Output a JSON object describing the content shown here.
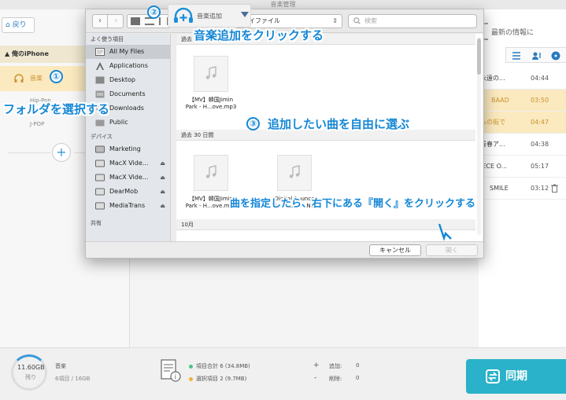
{
  "app": {
    "window_title": "音楽管理",
    "back_label": "戻り",
    "device_name": "俺のiPhone",
    "music_label": "音楽",
    "playlists": [
      "Hip-Pop",
      "J-POP"
    ],
    "latest_info": "最新の情報に",
    "tracks": [
      {
        "title": "永遠の...",
        "duration": "04:44"
      },
      {
        "title": "BAAD",
        "duration": "03:50"
      },
      {
        "title": "らの街で",
        "duration": "04:47"
      },
      {
        "title": "青春ア...",
        "duration": "04:38"
      },
      {
        "title": "IECE O...",
        "duration": "05:17"
      },
      {
        "title": "SMILE",
        "duration": "03:12"
      }
    ]
  },
  "bottom": {
    "storage_used": "11.60GB",
    "storage_sub": "残り",
    "category": "音楽",
    "category_detail": "6項目 / 16GB",
    "total_label": "項目合計 6 (34.8MB)",
    "selected_label": "選択項目 2 (9.7MB)",
    "added_label": "追加:",
    "added_value": "0",
    "deleted_label": "削除:",
    "deleted_value": "0",
    "sync_label": "同期",
    "plus": "+",
    "minus": "-"
  },
  "dialog": {
    "location": "マイファイル",
    "search_placeholder": "検索",
    "add_music_label": "音楽追加",
    "sidebar_favorites_header": "よく使う項目",
    "favorites": [
      "All My Files",
      "Applications",
      "Desktop",
      "Documents",
      "Downloads",
      "Public"
    ],
    "sidebar_devices_header": "デバイス",
    "devices": [
      "Marketing",
      "MacX Vide...",
      "MacX Vide...",
      "DearMob",
      "MediaTrans"
    ],
    "sidebar_shared_header": "共有",
    "sections": [
      {
        "header": "過去"
      },
      {
        "header": "過去 30 日間"
      },
      {
        "header": "10月"
      }
    ],
    "files_recent": [
      {
        "name_line1": "【MV】韓国Jimin",
        "name_line2": "Park - H...ove.mp3"
      }
    ],
    "files_30days": [
      {
        "name_line1": "【MV】韓国Jimin",
        "name_line2": "Park - H...ove.mp3"
      },
      {
        "name_line1": "Digital Bounce",
        "name_line2": "(From BIGBANG)"
      }
    ],
    "cancel_label": "キャンセル",
    "open_label": "開く"
  },
  "annotations": {
    "step1_num": "①",
    "step2_num": "②",
    "step3_num": "③",
    "step1_text": "フォルダを選択する",
    "step2_text": "音楽追加をクリックする",
    "step3_text": "追加したい曲を自由に選ぶ",
    "step4_text": "曲を指定したら、右下にある『開く』をクリックする"
  },
  "colors": {
    "annotation_blue": "#1587d6",
    "sync_button": "#29b2c9",
    "highlight_row": "#fbe9bf",
    "accent_text": "#c9932e"
  }
}
